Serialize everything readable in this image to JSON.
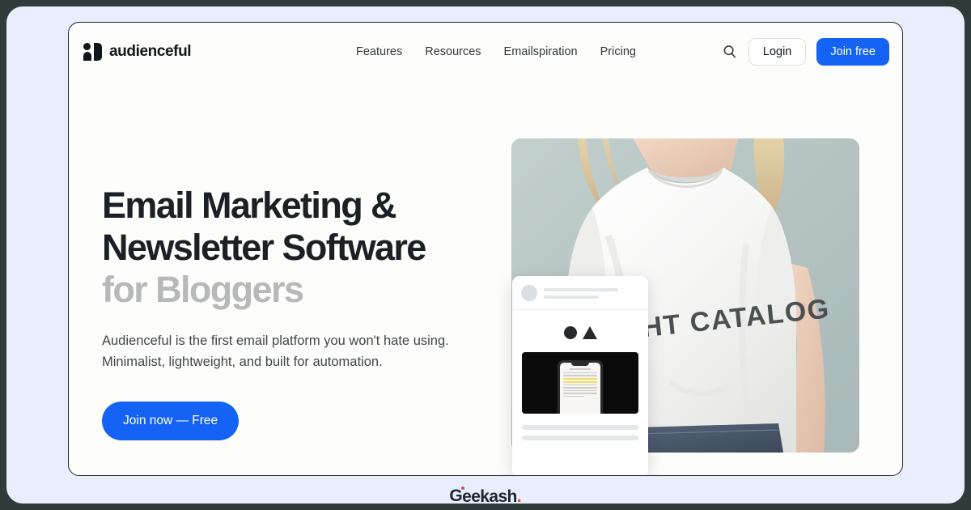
{
  "colors": {
    "frame": "#2f3a3a",
    "page_background": "#e8eefc",
    "card_background": "#fdfdfb",
    "accent_blue": "#1563f5",
    "headline_dark": "#1c2024",
    "headline_muted": "#b6b8ba",
    "photo_background": "#b8c6c5",
    "watermark_red": "#e8445a"
  },
  "header": {
    "brand_name": "audienceful",
    "brand_mark_icon": "audienceful-logo-icon",
    "nav": [
      {
        "label": "Features"
      },
      {
        "label": "Resources"
      },
      {
        "label": "Emailspiration"
      },
      {
        "label": "Pricing"
      }
    ],
    "search_icon": "search-icon",
    "login_label": "Login",
    "join_label": "Join free"
  },
  "hero": {
    "headline_line1": "Email Marketing &",
    "headline_line2": "Newsletter Software",
    "headline_line3": "for Bloggers",
    "subhead_line1": "Audienceful is the first email platform you won't hate",
    "subhead_line2": "using. Minimalist, lightweight, and built for automation.",
    "cta_label": "Join now — Free"
  },
  "hero_image": {
    "shirt_text": "THOUGHT CATALOG",
    "description": "person-in-white-tshirt-photo"
  },
  "post_card": {
    "logo_shapes": [
      "circle",
      "triangle"
    ],
    "media_description": "phone-showing-highlighted-document"
  },
  "watermark": {
    "name_head": "G",
    "name_tail": "eekash",
    "period": "."
  }
}
